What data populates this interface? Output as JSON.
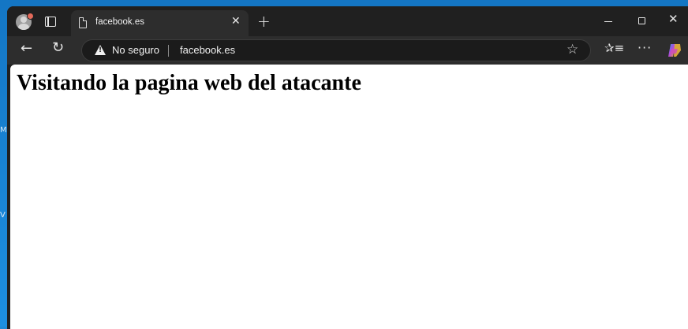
{
  "browser": {
    "tab": {
      "title": "facebook.es",
      "close_glyph": "✕",
      "page_icon": "page-icon"
    },
    "new_tab_glyph": "+",
    "window_controls": {
      "close_glyph": "✕"
    },
    "toolbar": {
      "back_glyph": "←",
      "reload_glyph": "↻",
      "security_label": "No seguro",
      "url": "facebook.es",
      "favorite_glyph": "☆",
      "favorites_glyph": "✰≡",
      "more_glyph": "···"
    }
  },
  "desktop": {
    "left_edge_letters": [
      "M",
      "V"
    ]
  },
  "page": {
    "heading": "Visitando la pagina web del atacante"
  },
  "colors": {
    "window_bg": "#202020",
    "toolbar_bg": "#2d2d2d",
    "omnibox_bg": "#1b1b1b",
    "page_bg": "#ffffff",
    "desktop_bg": "#1d8fe0"
  }
}
